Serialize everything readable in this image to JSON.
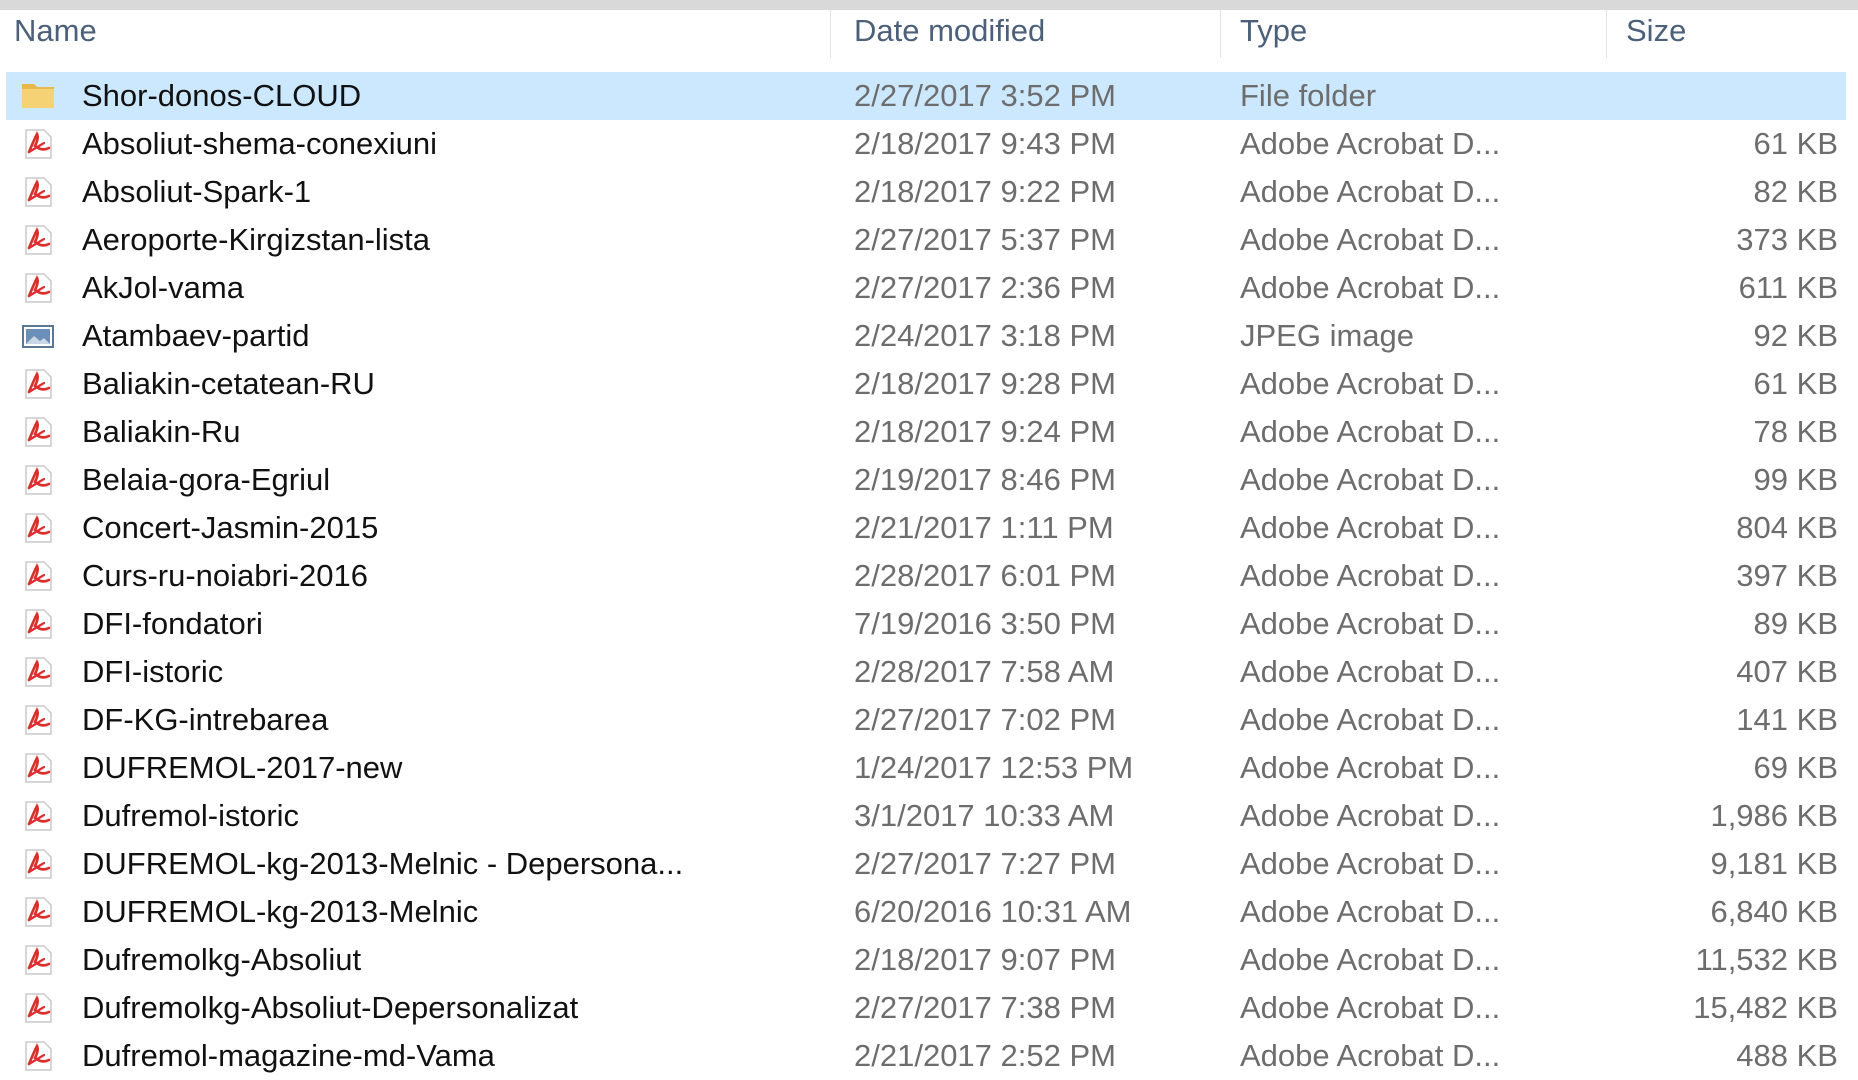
{
  "header": {
    "name": "Name",
    "date": "Date modified",
    "type": "Type",
    "size": "Size"
  },
  "colors": {
    "selection": "#cce8ff",
    "header_text": "#4c607a",
    "pdf_red": "#d9302c",
    "folder_yellow": "#f5d273"
  },
  "files": [
    {
      "icon": "folder-icon",
      "name": "Shor-donos-CLOUD",
      "date": "2/27/2017 3:52 PM",
      "type": "File folder",
      "size": "",
      "selected": true
    },
    {
      "icon": "pdf-icon",
      "name": "Absoliut-shema-conexiuni",
      "date": "2/18/2017 9:43 PM",
      "type": "Adobe Acrobat D...",
      "size": "61 KB"
    },
    {
      "icon": "pdf-icon",
      "name": "Absoliut-Spark-1",
      "date": "2/18/2017 9:22 PM",
      "type": "Adobe Acrobat D...",
      "size": "82 KB"
    },
    {
      "icon": "pdf-icon",
      "name": "Aeroporte-Kirgizstan-lista",
      "date": "2/27/2017 5:37 PM",
      "type": "Adobe Acrobat D...",
      "size": "373 KB"
    },
    {
      "icon": "pdf-icon",
      "name": "AkJol-vama",
      "date": "2/27/2017 2:36 PM",
      "type": "Adobe Acrobat D...",
      "size": "611 KB"
    },
    {
      "icon": "image-icon",
      "name": "Atambaev-partid",
      "date": "2/24/2017 3:18 PM",
      "type": "JPEG image",
      "size": "92 KB"
    },
    {
      "icon": "pdf-icon",
      "name": "Baliakin-cetatean-RU",
      "date": "2/18/2017 9:28 PM",
      "type": "Adobe Acrobat D...",
      "size": "61 KB"
    },
    {
      "icon": "pdf-icon",
      "name": "Baliakin-Ru",
      "date": "2/18/2017 9:24 PM",
      "type": "Adobe Acrobat D...",
      "size": "78 KB"
    },
    {
      "icon": "pdf-icon",
      "name": "Belaia-gora-Egriul",
      "date": "2/19/2017 8:46 PM",
      "type": "Adobe Acrobat D...",
      "size": "99 KB"
    },
    {
      "icon": "pdf-icon",
      "name": "Concert-Jasmin-2015",
      "date": "2/21/2017 1:11 PM",
      "type": "Adobe Acrobat D...",
      "size": "804 KB"
    },
    {
      "icon": "pdf-icon",
      "name": "Curs-ru-noiabri-2016",
      "date": "2/28/2017 6:01 PM",
      "type": "Adobe Acrobat D...",
      "size": "397 KB"
    },
    {
      "icon": "pdf-icon",
      "name": "DFI-fondatori",
      "date": "7/19/2016 3:50 PM",
      "type": "Adobe Acrobat D...",
      "size": "89 KB"
    },
    {
      "icon": "pdf-icon",
      "name": "DFI-istoric",
      "date": "2/28/2017 7:58 AM",
      "type": "Adobe Acrobat D...",
      "size": "407 KB"
    },
    {
      "icon": "pdf-icon",
      "name": "DF-KG-intrebarea",
      "date": "2/27/2017 7:02 PM",
      "type": "Adobe Acrobat D...",
      "size": "141 KB"
    },
    {
      "icon": "pdf-icon",
      "name": "DUFREMOL-2017-new",
      "date": "1/24/2017 12:53 PM",
      "type": "Adobe Acrobat D...",
      "size": "69 KB"
    },
    {
      "icon": "pdf-icon",
      "name": "Dufremol-istoric",
      "date": "3/1/2017 10:33 AM",
      "type": "Adobe Acrobat D...",
      "size": "1,986 KB"
    },
    {
      "icon": "pdf-icon",
      "name": "DUFREMOL-kg-2013-Melnic - Depersona...",
      "date": "2/27/2017 7:27 PM",
      "type": "Adobe Acrobat D...",
      "size": "9,181 KB"
    },
    {
      "icon": "pdf-icon",
      "name": "DUFREMOL-kg-2013-Melnic",
      "date": "6/20/2016 10:31 AM",
      "type": "Adobe Acrobat D...",
      "size": "6,840 KB"
    },
    {
      "icon": "pdf-icon",
      "name": "Dufremolkg-Absoliut",
      "date": "2/18/2017 9:07 PM",
      "type": "Adobe Acrobat D...",
      "size": "11,532 KB"
    },
    {
      "icon": "pdf-icon",
      "name": "Dufremolkg-Absoliut-Depersonalizat",
      "date": "2/27/2017 7:38 PM",
      "type": "Adobe Acrobat D...",
      "size": "15,482 KB"
    },
    {
      "icon": "pdf-icon",
      "name": "Dufremol-magazine-md-Vama",
      "date": "2/21/2017 2:52 PM",
      "type": "Adobe Acrobat D...",
      "size": "488 KB"
    }
  ]
}
